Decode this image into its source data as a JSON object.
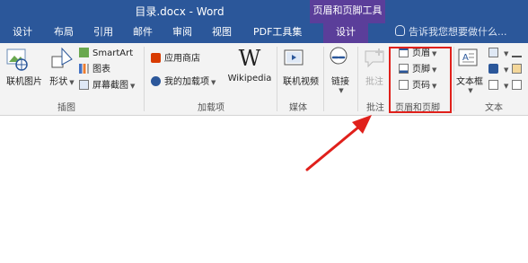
{
  "window": {
    "doc_title": "目录.docx - Word",
    "context_title": "页眉和页脚工具"
  },
  "tabs": [
    {
      "label": "设计"
    },
    {
      "label": "布局"
    },
    {
      "label": "引用"
    },
    {
      "label": "邮件"
    },
    {
      "label": "审阅"
    },
    {
      "label": "视图"
    },
    {
      "label": "PDF工具集"
    },
    {
      "label": "设计"
    }
  ],
  "tell_me": "告诉我您想要做什么...",
  "ribbon": {
    "illustrations": {
      "online_pictures": "联机图片",
      "shapes": "形状",
      "smartart": "SmartArt",
      "chart": "图表",
      "screenshot": "屏幕截图",
      "group": "插图"
    },
    "addins": {
      "store": "应用商店",
      "my_addins": "我的加载项",
      "wikipedia": "Wikipedia",
      "group": "加载项"
    },
    "media": {
      "online_video": "联机视频",
      "group": "媒体"
    },
    "links": {
      "link": "链接"
    },
    "comments": {
      "comment": "批注",
      "group": "批注"
    },
    "header_footer": {
      "header": "页眉",
      "footer": "页脚",
      "page_number": "页码",
      "group": "页眉和页脚"
    },
    "text": {
      "textbox": "文本框",
      "group": "文本"
    }
  },
  "colors": {
    "title_bar": "#2b579a",
    "context_tab": "#5b3e9a",
    "highlight": "#e0201b"
  }
}
